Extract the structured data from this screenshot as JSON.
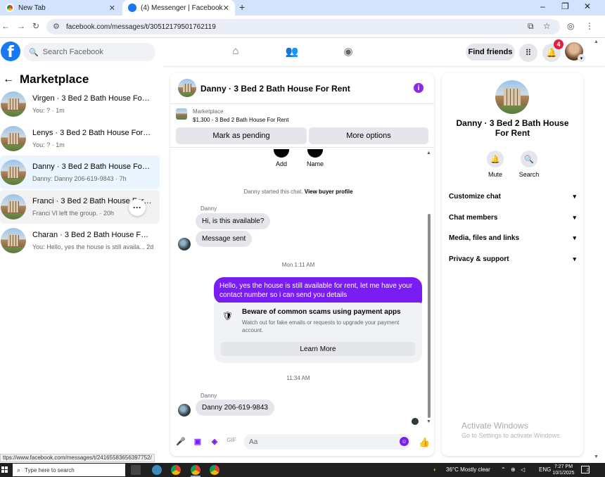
{
  "browser": {
    "tabs": [
      {
        "title": "New Tab",
        "active": false
      },
      {
        "title": "(4) Messenger | Facebook",
        "active": true
      }
    ],
    "new_tab_symbol": "+",
    "url": "facebook.com/messages/t/30512179501762119",
    "window_controls": [
      "–",
      "❐",
      "✕"
    ]
  },
  "fb_header": {
    "logo_letter": "f",
    "search_placeholder": "Search Facebook",
    "nav_icons": [
      "home-icon",
      "friends-icon",
      "groups-icon"
    ],
    "find_friends_label": "Find friends",
    "notification_count": "4",
    "brand_color": "#1877f2"
  },
  "left_panel": {
    "title": "Marketplace",
    "conversations": [
      {
        "name": "Virgen · 3 Bed 2 Bath House For R...",
        "subtitle": "You: ? · 1m"
      },
      {
        "name": "Lenys · 3 Bed 2 Bath House For Rent",
        "subtitle": "You: ? · 1m"
      },
      {
        "name": "Danny · 3 Bed 2 Bath House For R...",
        "subtitle": "Danny: Danny 206-619-9843 · 7h"
      },
      {
        "name": "Franci · 3 Bed 2 Bath House For Rent",
        "subtitle": "Franci Vl left the group. · 20h"
      },
      {
        "name": "Charan · 3 Bed 2 Bath House For R...",
        "subtitle": "You: Hello, yes the house is still availa...   2d"
      }
    ],
    "more_button_label": "···"
  },
  "chat": {
    "title": "Danny · 3 Bed 2 Bath House For Rent",
    "info_symbol": "i",
    "listing": {
      "label": "Marketplace",
      "detail": "$1,300 - 3 Bed 2 Bath House For Rent"
    },
    "mark_pending_label": "Mark as pending",
    "more_options_label": "More options",
    "quick_actions": [
      {
        "label": "Add"
      },
      {
        "label": "Name"
      }
    ],
    "started_text": "Danny started this chat.",
    "view_profile_label": "View buyer profile",
    "sender_name": "Danny",
    "incoming_1": "Hi, is this available?",
    "incoming_2": "Message sent",
    "timestamp_1": "Mon 1:11 AM",
    "outgoing": "Hello, yes the house is still available for rent, let me have your contact number so i can send you  details",
    "scam_title": "Beware of common scams using payment apps",
    "scam_desc": "Watch out for fake emails or requests to upgrade your payment account.",
    "learn_more_label": "Learn More",
    "timestamp_2": "11:34 AM",
    "incoming_3": "Danny 206-619-9843",
    "composer_placeholder": "Aa",
    "accent_color": "#7a1df5"
  },
  "info_panel": {
    "title": "Danny · 3 Bed 2 Bath House For Rent",
    "actions": [
      {
        "label": "Mute"
      },
      {
        "label": "Search"
      }
    ],
    "sections": [
      "Customize chat",
      "Chat members",
      "Media, files and links",
      "Privacy & support"
    ],
    "watermark_title": "Activate Windows",
    "watermark_sub": "Go to Settings to activate Windows."
  },
  "status_link": "ttps://www.facebook.com/messages/t/24165583656397752/",
  "taskbar": {
    "search_placeholder": "Type here to search",
    "weather": "36°C  Mostly clear",
    "lang": "ENG",
    "time": "7:27 PM",
    "date": "10/1/2025",
    "notif_count": "2"
  }
}
